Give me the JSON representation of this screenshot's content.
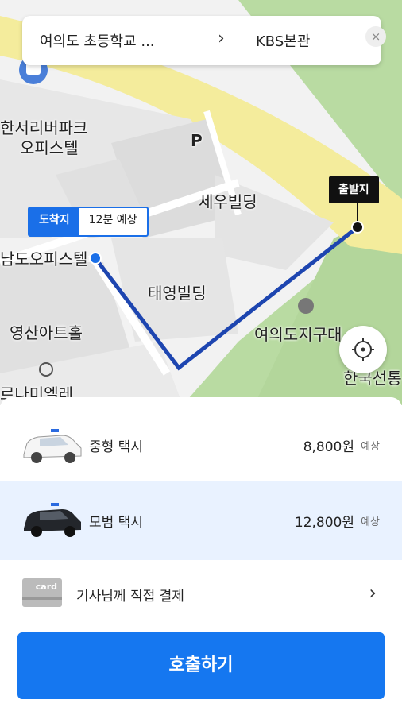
{
  "route": {
    "from": "여의도 초등학교 ...",
    "arrow": "›",
    "to": "KBS본관",
    "close": "×"
  },
  "map": {
    "labels": {
      "hansori": "한서리버파크",
      "officetel": "오피스텔",
      "parking": "P",
      "sewoo": "세우빌딩",
      "namdo": "남도오피스텔",
      "taeyoung": "태영빌딩",
      "yeongsan": "영산아트홀",
      "yeouido": "여의도지구대",
      "luna": "르나미엘레",
      "hanguk": "한국선통"
    },
    "dest_tag_label": "도착지",
    "dest_tag_eta": "12분 예상",
    "start_tag": "출발지",
    "accent": "#1a6fe8",
    "route_color": "#1d45b0"
  },
  "rides": [
    {
      "name": "중형 택시",
      "price": "8,800원",
      "est": "예상",
      "selected": false
    },
    {
      "name": "모범 택시",
      "price": "12,800원",
      "est": "예상",
      "selected": true
    }
  ],
  "payment": {
    "card_text": "card",
    "label": "기사님께 직접 결제",
    "chevron": "›"
  },
  "call_button": "호출하기"
}
